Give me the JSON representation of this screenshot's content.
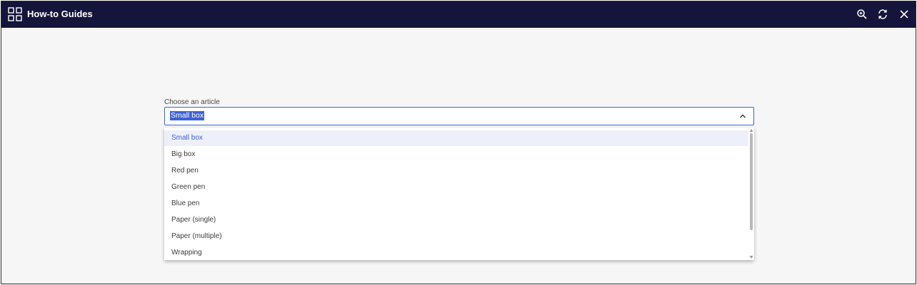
{
  "titlebar": {
    "title": "How-to Guides",
    "background": "#15143a",
    "icons": {
      "app": "grid-icon",
      "zoom": "zoom-search-icon",
      "refresh": "refresh-icon",
      "close": "close-icon"
    }
  },
  "form": {
    "label": "Choose an article",
    "selected_value": "Small box",
    "accent_color": "#3d62d4",
    "options": [
      "Small box",
      "Big box",
      "Red pen",
      "Green pen",
      "Blue pen",
      "Paper (single)",
      "Paper (multiple)",
      "Wrapping"
    ]
  }
}
